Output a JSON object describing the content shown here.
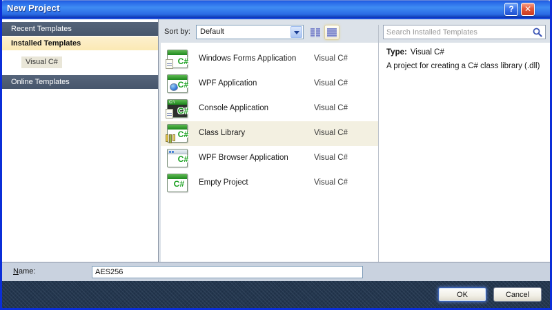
{
  "window": {
    "title": "New Project",
    "help_glyph": "?",
    "close_glyph": "✕"
  },
  "sidebar": {
    "recent": "Recent Templates",
    "installed": "Installed Templates",
    "visual_csharp": "Visual C#",
    "online": "Online Templates"
  },
  "toolbar": {
    "sort_by_label": "Sort by:",
    "sort_value": "Default"
  },
  "search": {
    "placeholder": "Search Installed Templates"
  },
  "templates": {
    "selected_index": 3,
    "items": [
      {
        "name": "Windows Forms Application",
        "language": "Visual C#"
      },
      {
        "name": "WPF Application",
        "language": "Visual C#"
      },
      {
        "name": "Console Application",
        "language": "Visual C#"
      },
      {
        "name": "Class Library",
        "language": "Visual C#"
      },
      {
        "name": "WPF Browser Application",
        "language": "Visual C#"
      },
      {
        "name": "Empty Project",
        "language": "Visual C#"
      }
    ]
  },
  "details": {
    "type_label": "Type:",
    "type_value": "Visual C#",
    "description": "A project for creating a C# class library (.dll)"
  },
  "icons": {
    "csharp": "C#",
    "console_prompt": "C:\\"
  },
  "footer": {
    "name_label_mnemonic": "N",
    "name_label_rest": "ame:",
    "name_value": "AES256",
    "ok_label": "OK",
    "cancel_label": "Cancel"
  },
  "colors": {
    "titlebar_blue": "#2e6be4",
    "window_border": "#0b2ed8",
    "band_dark": "#4c5b70",
    "band_cream": "#fbe9b4",
    "selection_cream": "#f3f0e1",
    "csharp_green": "#18a01e"
  }
}
